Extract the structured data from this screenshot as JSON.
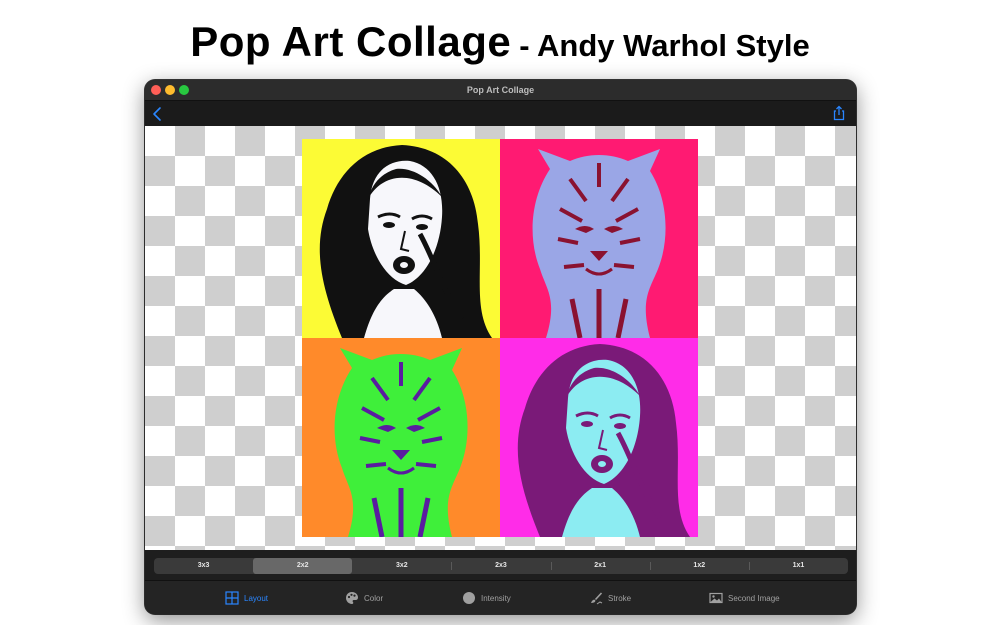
{
  "page": {
    "headline": "Pop Art Collage",
    "subheadline": "- Andy Warhol Style"
  },
  "window": {
    "title": "Pop Art Collage"
  },
  "navbar": {
    "back_icon": "chevron-left-icon",
    "share_icon": "share-icon"
  },
  "collage": {
    "tiles": [
      {
        "subject": "woman",
        "background": "#fcfb35",
        "shadow": "#111111",
        "skin": "#f7f7fb"
      },
      {
        "subject": "tiger",
        "background": "#ff1a72",
        "shadow": "#8a1230",
        "skin": "#9aa6e6"
      },
      {
        "subject": "tiger",
        "background": "#ff8a2a",
        "shadow": "#5a1ca0",
        "skin": "#3fef3a"
      },
      {
        "subject": "woman",
        "background": "#ff2ce8",
        "shadow": "#7a1a78",
        "skin": "#8cecf2"
      }
    ]
  },
  "layout_options": {
    "items": [
      "3x3",
      "2x2",
      "3x2",
      "2x3",
      "2x1",
      "1x2",
      "1x1"
    ],
    "selected": "2x2"
  },
  "toolbar": {
    "items": [
      {
        "label": "Layout",
        "icon": "grid-icon",
        "active": true
      },
      {
        "label": "Color",
        "icon": "palette-icon",
        "active": false
      },
      {
        "label": "Intensity",
        "icon": "circle-icon",
        "active": false
      },
      {
        "label": "Stroke",
        "icon": "brush-icon",
        "active": false
      },
      {
        "label": "Second Image",
        "icon": "image-icon",
        "active": false
      }
    ]
  },
  "colors": {
    "accent": "#2a86ff",
    "window_bg": "#1e1e1e"
  }
}
